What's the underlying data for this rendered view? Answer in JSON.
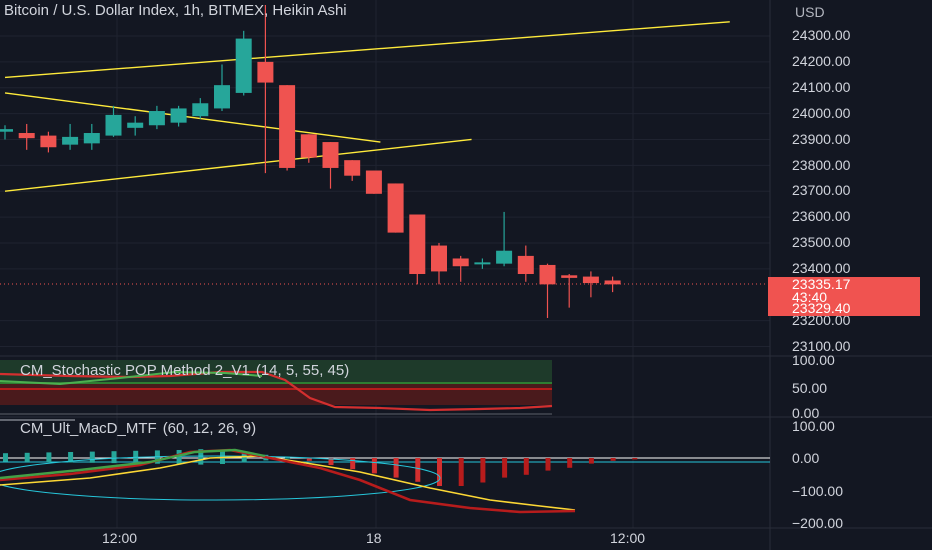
{
  "symbol_title": "Bitcoin / U.S. Dollar Index, 1h, BITMEX, Heikin Ashi",
  "currency": "USD",
  "price_axis": [
    "24300.00",
    "24200.00",
    "24100.00",
    "24000.00",
    "23900.00",
    "23800.00",
    "23700.00",
    "23600.00",
    "23500.00",
    "23400.00",
    "23200.00",
    "23100.00"
  ],
  "last_price": {
    "value": "23335.17",
    "countdown": "43:40",
    "prev": "23329.40"
  },
  "stochastic": {
    "name": "CM_Stochastic POP Method 2_V1",
    "params": "(14, 5, 55, 45)",
    "axis": [
      "100.00",
      "50.00",
      "0.00"
    ]
  },
  "macd": {
    "name": "CM_Ult_MacD_MTF",
    "params": "(60, 12, 26, 9)",
    "axis": [
      "100.00",
      "0.00",
      "−100.00",
      "−200.00"
    ]
  },
  "time_axis": [
    "12:00",
    "18",
    "12:00"
  ],
  "colors": {
    "bg": "#131722",
    "up": "#26a69a",
    "down": "#ef5350",
    "trendline": "#ffeb3b"
  },
  "candles": [
    {
      "t": 0,
      "o": 23930,
      "h": 23955,
      "l": 23900,
      "c": 23940
    },
    {
      "t": 1,
      "o": 23925,
      "h": 23960,
      "l": 23860,
      "c": 23905
    },
    {
      "t": 2,
      "o": 23915,
      "h": 23930,
      "l": 23850,
      "c": 23870
    },
    {
      "t": 3,
      "o": 23880,
      "h": 23960,
      "l": 23860,
      "c": 23910
    },
    {
      "t": 4,
      "o": 23885,
      "h": 23960,
      "l": 23860,
      "c": 23925
    },
    {
      "t": 5,
      "o": 23915,
      "h": 24030,
      "l": 23910,
      "c": 23995
    },
    {
      "t": 6,
      "o": 23945,
      "h": 23990,
      "l": 23915,
      "c": 23965
    },
    {
      "t": 7,
      "o": 23955,
      "h": 24030,
      "l": 23940,
      "c": 24010
    },
    {
      "t": 8,
      "o": 23965,
      "h": 24030,
      "l": 23950,
      "c": 24020
    },
    {
      "t": 9,
      "o": 23990,
      "h": 24060,
      "l": 23980,
      "c": 24040
    },
    {
      "t": 10,
      "o": 24020,
      "h": 24190,
      "l": 24010,
      "c": 24110
    },
    {
      "t": 11,
      "o": 24080,
      "h": 24320,
      "l": 24070,
      "c": 24290
    },
    {
      "t": 12,
      "o": 24200,
      "h": 24420,
      "l": 23770,
      "c": 24120
    },
    {
      "t": 13,
      "o": 24110,
      "h": 24110,
      "l": 23780,
      "c": 23790
    },
    {
      "t": 14,
      "o": 23920,
      "h": 23920,
      "l": 23810,
      "c": 23830
    },
    {
      "t": 15,
      "o": 23890,
      "h": 23890,
      "l": 23710,
      "c": 23790
    },
    {
      "t": 16,
      "o": 23820,
      "h": 23820,
      "l": 23740,
      "c": 23760
    },
    {
      "t": 17,
      "o": 23780,
      "h": 23780,
      "l": 23690,
      "c": 23690
    },
    {
      "t": 18,
      "o": 23730,
      "h": 23730,
      "l": 23540,
      "c": 23540
    },
    {
      "t": 19,
      "o": 23610,
      "h": 23610,
      "l": 23340,
      "c": 23380
    },
    {
      "t": 20,
      "o": 23490,
      "h": 23500,
      "l": 23340,
      "c": 23390
    },
    {
      "t": 21,
      "o": 23440,
      "h": 23450,
      "l": 23350,
      "c": 23410
    },
    {
      "t": 22,
      "o": 23420,
      "h": 23440,
      "l": 23400,
      "c": 23425
    },
    {
      "t": 23,
      "o": 23420,
      "h": 23620,
      "l": 23410,
      "c": 23470
    },
    {
      "t": 24,
      "o": 23450,
      "h": 23490,
      "l": 23350,
      "c": 23380
    },
    {
      "t": 25,
      "o": 23415,
      "h": 23420,
      "l": 23210,
      "c": 23340
    },
    {
      "t": 26,
      "o": 23375,
      "h": 23380,
      "l": 23250,
      "c": 23365
    },
    {
      "t": 27,
      "o": 23370,
      "h": 23390,
      "l": 23290,
      "c": 23345
    },
    {
      "t": 28,
      "o": 23355,
      "h": 23370,
      "l": 23310,
      "c": 23340
    }
  ],
  "macd_hist": [
    12,
    13,
    14,
    15,
    16,
    17,
    18,
    19,
    20,
    22,
    20,
    14,
    8,
    2,
    -4,
    -10,
    -16,
    -22,
    -28,
    -34,
    -40,
    -40,
    -35,
    -28,
    -24,
    -18,
    -14,
    -8,
    -4,
    -2
  ],
  "trendlines": [
    {
      "p1": [
        0,
        24140
      ],
      "p2": [
        33.4,
        24355
      ]
    },
    {
      "p1": [
        0,
        23700
      ],
      "p2": [
        21.5,
        23900
      ]
    },
    {
      "p1": [
        0,
        24080
      ],
      "p2": [
        17.3,
        23890
      ]
    }
  ]
}
